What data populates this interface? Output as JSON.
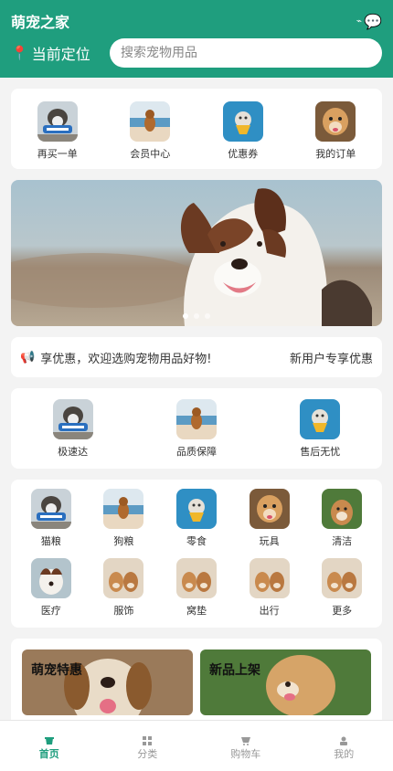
{
  "header": {
    "title": "萌宠之家",
    "location_label": "当前定位",
    "search_placeholder": "搜索宠物用品",
    "accent": "#1f9e7e"
  },
  "quick_entries": [
    {
      "label": "再买一单",
      "icon": "dog-chew-photo"
    },
    {
      "label": "会员中心",
      "icon": "dog-beach-photo"
    },
    {
      "label": "优惠券",
      "icon": "dog-scarf-photo"
    },
    {
      "label": "我的订单",
      "icon": "dog-happy-photo"
    }
  ],
  "banner": {
    "icon": "border-collie-photo",
    "slides": 3,
    "active_slide": 0
  },
  "notice": {
    "text": "享优惠，欢迎选购宠物用品好物!",
    "right_text": "新用户专享优惠"
  },
  "services": [
    {
      "label": "极速达",
      "icon": "dog-chew-photo"
    },
    {
      "label": "品质保障",
      "icon": "dog-beach-photo"
    },
    {
      "label": "售后无忧",
      "icon": "dog-scarf-photo"
    }
  ],
  "categories": [
    {
      "label": "猫粮"
    },
    {
      "label": "狗粮"
    },
    {
      "label": "零食"
    },
    {
      "label": "玩具"
    },
    {
      "label": "清洁"
    },
    {
      "label": "医疗"
    },
    {
      "label": "服饰"
    },
    {
      "label": "窝垫"
    },
    {
      "label": "出行"
    },
    {
      "label": "更多"
    }
  ],
  "promos": [
    {
      "title": "萌宠特惠"
    },
    {
      "title": "新品上架"
    }
  ],
  "tabbar": [
    {
      "label": "首页",
      "icon": "home-icon",
      "active": true
    },
    {
      "label": "分类",
      "icon": "grid-icon",
      "active": false
    },
    {
      "label": "购物车",
      "icon": "cart-icon",
      "active": false
    },
    {
      "label": "我的",
      "icon": "user-icon",
      "active": false
    }
  ]
}
